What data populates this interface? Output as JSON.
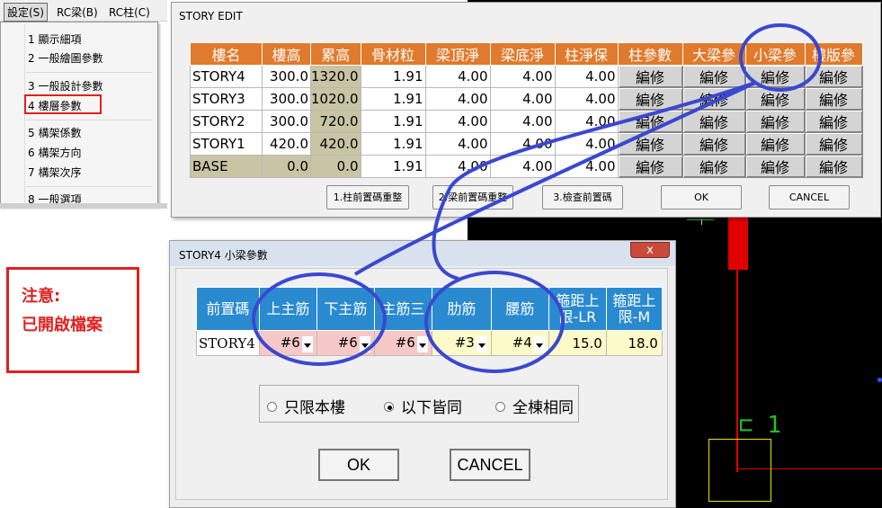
{
  "menubar": {
    "items": [
      "設定(S)",
      "RC梁(B)",
      "RC柱(C)"
    ]
  },
  "dropdown": {
    "items": [
      "1 顯示細項",
      "2 一般繪圖參數",
      "3 一般設計參數",
      "4 樓層參數",
      "5 構架係數",
      "6 構架方向",
      "7 構架次序",
      "8 一般選項"
    ]
  },
  "note": {
    "line1": "注意:",
    "line2": "已開啟檔案"
  },
  "story_edit": {
    "title": "STORY EDIT",
    "headers": [
      "樓名",
      "樓高",
      "累高",
      "骨材粒",
      "梁頂淨",
      "梁底淨",
      "柱淨保",
      "柱參數",
      "大梁參",
      "小梁參",
      "樓版參"
    ],
    "rows": [
      {
        "name": "STORY4",
        "h": "300.0",
        "cum": "1320.0",
        "agg": "1.91",
        "top": "4.00",
        "bot": "4.00",
        "col": "4.00"
      },
      {
        "name": "STORY3",
        "h": "300.0",
        "cum": "1020.0",
        "agg": "1.91",
        "top": "4.00",
        "bot": "4.00",
        "col": "4.00"
      },
      {
        "name": "STORY2",
        "h": "300.0",
        "cum": "720.0",
        "agg": "1.91",
        "top": "4.00",
        "bot": "4.00",
        "col": "4.00"
      },
      {
        "name": "STORY1",
        "h": "420.0",
        "cum": "420.0",
        "agg": "1.91",
        "top": "4.00",
        "bot": "4.00",
        "col": "4.00"
      },
      {
        "name": "BASE",
        "h": "0.0",
        "cum": "0.0",
        "agg": "1.91",
        "top": "4.00",
        "bot": "4.00",
        "col": "4.00"
      }
    ],
    "edit_label": "編修",
    "buttons": [
      "1.柱前置碼重整",
      "2.梁前置碼重整",
      "3.檢查前置碼",
      "OK",
      "CANCEL"
    ]
  },
  "sub_dialog": {
    "title": "STORY4 小梁參數",
    "close_label": "x",
    "headers": [
      "前置碼",
      "上主筋",
      "下主筋",
      "主筋三",
      "肋筋",
      "腰筋",
      "箍距上\n限-LR",
      "箍距上\n限-M"
    ],
    "row": [
      "STORY4",
      "#6",
      "#6",
      "#6",
      "#3",
      "#4",
      "15.0",
      "18.0"
    ],
    "radios": [
      {
        "label": "只限本樓",
        "checked": false
      },
      {
        "label": "以下皆同",
        "checked": true
      },
      {
        "label": "全棟相同",
        "checked": false
      }
    ],
    "ok_label": "OK",
    "cancel_label": "CANCEL"
  },
  "colors": {
    "orange_header": "#e07a2c",
    "blue_header": "#2a8ad0",
    "annotation_red": "#e02020",
    "annotation_blue": "#3a48d0"
  }
}
